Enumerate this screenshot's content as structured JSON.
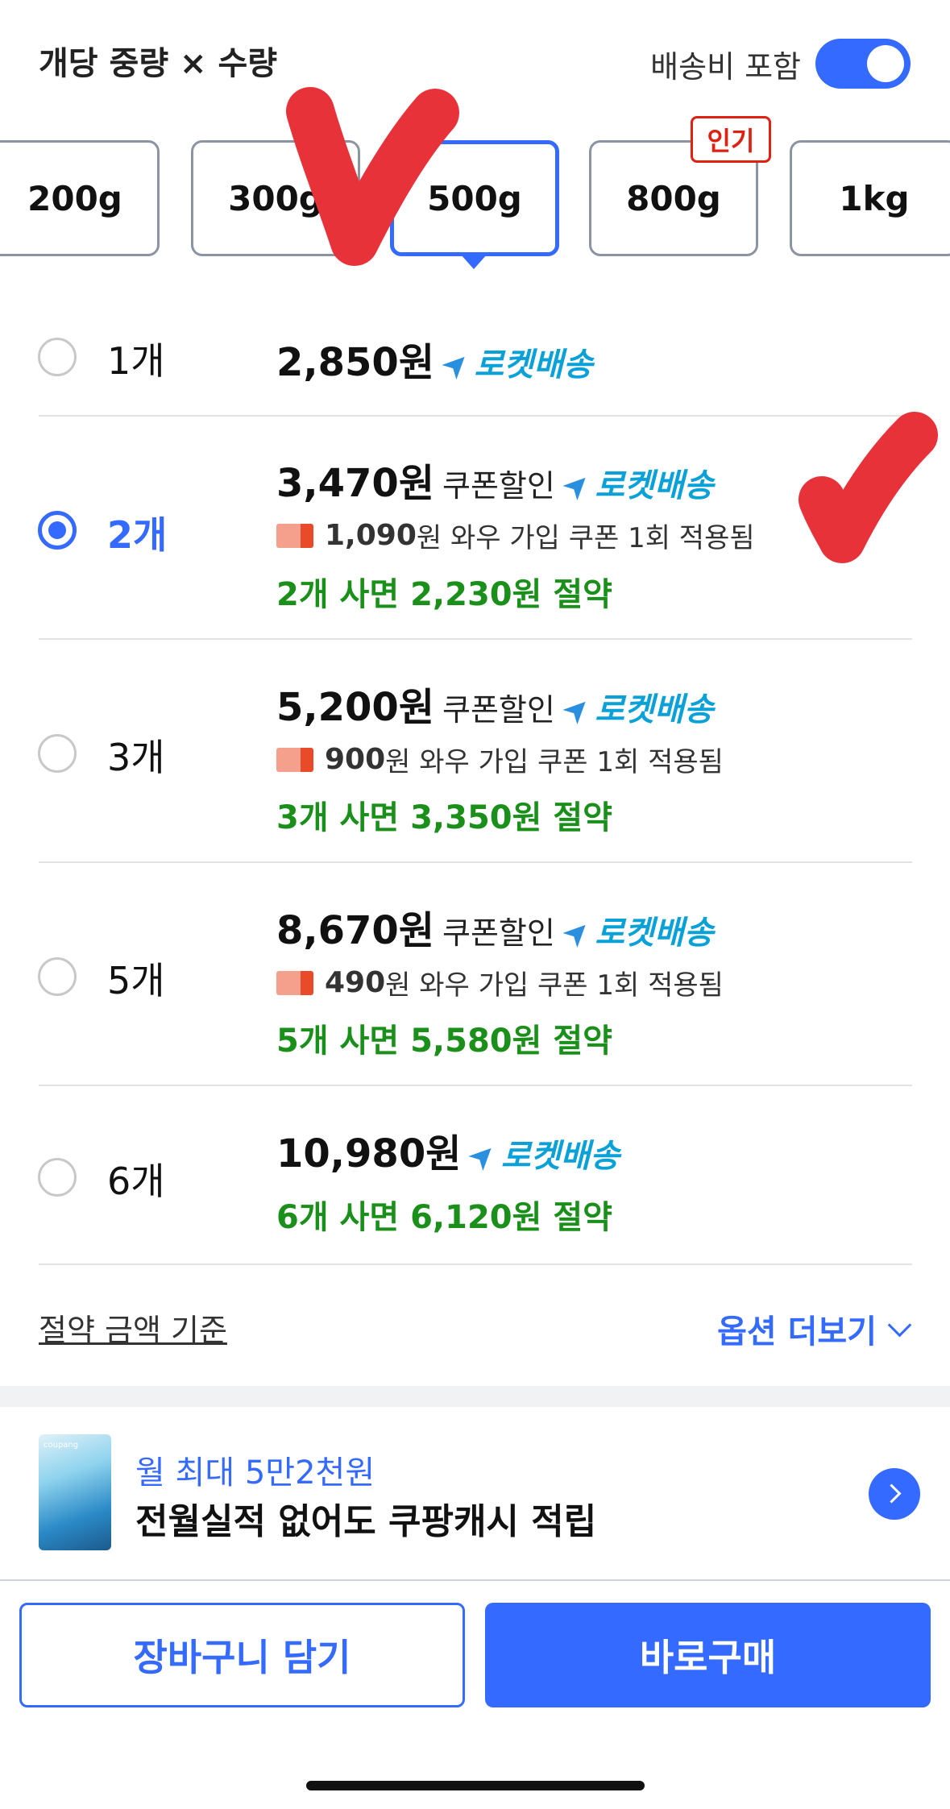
{
  "header": {
    "title": "개당 중량 × 수량",
    "shipping_label": "배송비 포함",
    "shipping_toggle_on": true
  },
  "weights": [
    {
      "label": "200g",
      "selected": false
    },
    {
      "label": "300g",
      "selected": false
    },
    {
      "label": "500g",
      "selected": true
    },
    {
      "label": "800g",
      "selected": false,
      "badge": "인기"
    },
    {
      "label": "1kg",
      "selected": false
    }
  ],
  "options": [
    {
      "qty": "1개",
      "price": "2,850원",
      "coupon_label": "",
      "delivery": "로켓배송",
      "coupon_amount": "",
      "coupon_text": "",
      "save_text": "",
      "selected": false
    },
    {
      "qty": "2개",
      "price": "3,470원",
      "coupon_label": "쿠폰할인",
      "delivery": "로켓배송",
      "coupon_amount": "1,090",
      "coupon_text": "원 와우 가입 쿠폰 1회 적용됨",
      "save_text": "2개 사면 2,230원 절약",
      "selected": true
    },
    {
      "qty": "3개",
      "price": "5,200원",
      "coupon_label": "쿠폰할인",
      "delivery": "로켓배송",
      "coupon_amount": "900",
      "coupon_text": "원 와우 가입 쿠폰 1회 적용됨",
      "save_text": "3개 사면 3,350원 절약",
      "selected": false
    },
    {
      "qty": "5개",
      "price": "8,670원",
      "coupon_label": "쿠폰할인",
      "delivery": "로켓배송",
      "coupon_amount": "490",
      "coupon_text": "원 와우 가입 쿠폰 1회 적용됨",
      "save_text": "5개 사면 5,580원 절약",
      "selected": false
    },
    {
      "qty": "6개",
      "price": "10,980원",
      "coupon_label": "",
      "delivery": "로켓배송",
      "coupon_amount": "",
      "coupon_text": "",
      "save_text": "6개 사면 6,120원 절약",
      "selected": false
    }
  ],
  "footer_links": {
    "basis": "절약 금액 기준",
    "more": "옵션 더보기"
  },
  "promo": {
    "line1": "월 최대 5만2천원",
    "line2": "전월실적 없어도 쿠팡캐시 적립",
    "card_brand": "coupang"
  },
  "actions": {
    "cart": "장바구니 담기",
    "buy": "바로구매"
  },
  "colors": {
    "accent": "#346aff",
    "rocket": "#0aa0d8",
    "save": "#1a8f1a",
    "badge": "#e02010",
    "annotation": "#e8323a"
  }
}
